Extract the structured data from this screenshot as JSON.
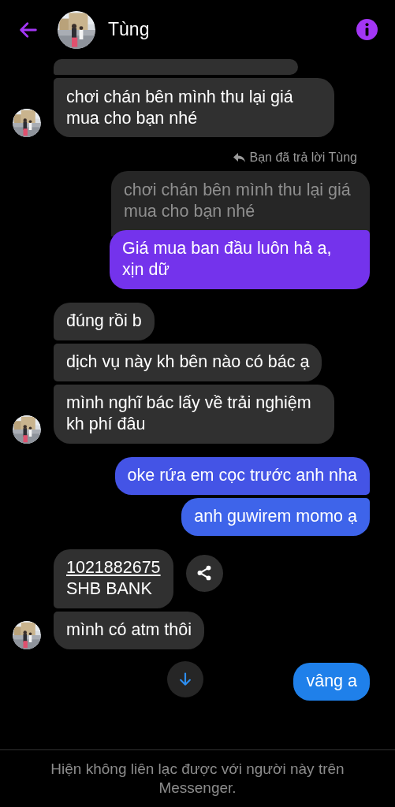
{
  "header": {
    "title": "Tùng"
  },
  "messages": [
    {
      "kind": "clipped",
      "avatar": false
    },
    {
      "kind": "received",
      "text": "chơi chán bên mình thu lại giá mua cho bạn nhé",
      "avatar": true
    },
    {
      "kind": "reply_label",
      "text": "Bạn đã trả lời Tùng"
    },
    {
      "kind": "quoted",
      "text": "chơi chán bên mình thu lại giá mua cho bạn nhé"
    },
    {
      "kind": "sent",
      "text": "Giá mua ban đầu luôn hả a, xịn dữ",
      "color": "#7433ec"
    },
    {
      "kind": "received",
      "text": "đúng rồi b",
      "avatar": false
    },
    {
      "kind": "received",
      "text": "dịch vụ này kh bên nào có bác ạ",
      "avatar": false
    },
    {
      "kind": "received",
      "text": "mình nghĩ bác lấy về trải nghiệm kh phí đâu",
      "avatar": true
    },
    {
      "kind": "sent",
      "text": "oke rứa em cọc trước anh nha",
      "color": "#4454e6"
    },
    {
      "kind": "sent",
      "text": "anh guwirem momo ạ",
      "color": "#3e64ea"
    },
    {
      "kind": "bank",
      "lines": [
        "1021882675",
        "SHB BANK"
      ],
      "avatar": false
    },
    {
      "kind": "received",
      "text": "mình có atm thôi",
      "avatar": true
    },
    {
      "kind": "sent",
      "text": "vâng a",
      "color": "#1f80ea"
    }
  ],
  "footer": {
    "notice": "Hiện không liên lạc được với người này trên Messenger."
  }
}
